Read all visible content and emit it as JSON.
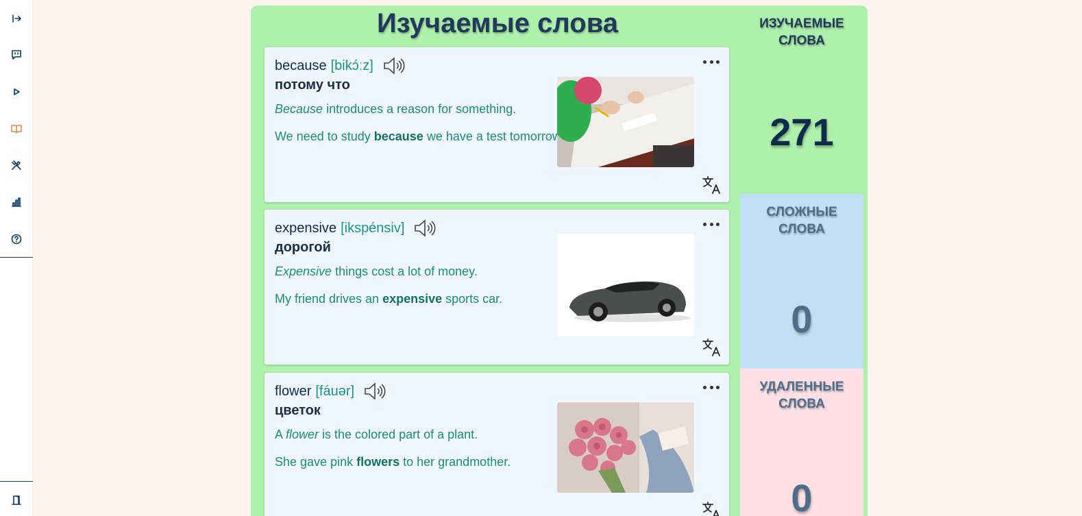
{
  "page": {
    "title": "Изучаемые слова"
  },
  "sidebar": {
    "items": [
      {
        "icon": "arrow-right-icon"
      },
      {
        "icon": "chat-icon"
      },
      {
        "icon": "play-icon"
      },
      {
        "icon": "book-icon",
        "active": true
      },
      {
        "icon": "tools-icon"
      },
      {
        "icon": "chart-icon"
      },
      {
        "icon": "help-icon"
      },
      {
        "icon": "exit-door-icon"
      }
    ]
  },
  "cards": [
    {
      "word": "because",
      "transcription": "[bikɔ́ːz]",
      "translation": "потому что",
      "definition_word": "Because",
      "definition_rest": " introduces a reason for something.",
      "example_before": "We need to study ",
      "example_word": "because",
      "example_after": " we have a test tomorrow.",
      "image": "classroom-students-writing"
    },
    {
      "word": "expensive",
      "transcription": "[ikspénsiv]",
      "translation": "дорогой",
      "definition_word": "Expensive",
      "definition_rest": " things cost a lot of money.",
      "example_before": "My friend drives an ",
      "example_word": "expensive",
      "example_after": " sports car.",
      "image": "sports-car"
    },
    {
      "word": "flower",
      "transcription": "[fáuər]",
      "translation": "цветок",
      "definition_prefix": "A ",
      "definition_word": "flower",
      "definition_rest": " is the colored part of a plant.",
      "example_before": "She gave pink ",
      "example_word": "flowers",
      "example_after": " to her grandmother.",
      "image": "pink-roses-bouquet"
    }
  ],
  "stats": [
    {
      "label_line1": "ИЗУЧАЕМЫЕ",
      "label_line2": "СЛОВА",
      "value": "271",
      "bg": "#aeefab",
      "color": "#0d2c4a"
    },
    {
      "label_line1": "СЛОЖНЫЕ",
      "label_line2": "СЛОВА",
      "value": "0",
      "bg": "#bfe0f5",
      "color": "#4d6d8a"
    },
    {
      "label_line1": "УДАЛЕННЫЕ",
      "label_line2": "СЛОВА",
      "value": "0",
      "bg": "#fde0e5",
      "color": "#4d6d8a"
    }
  ]
}
